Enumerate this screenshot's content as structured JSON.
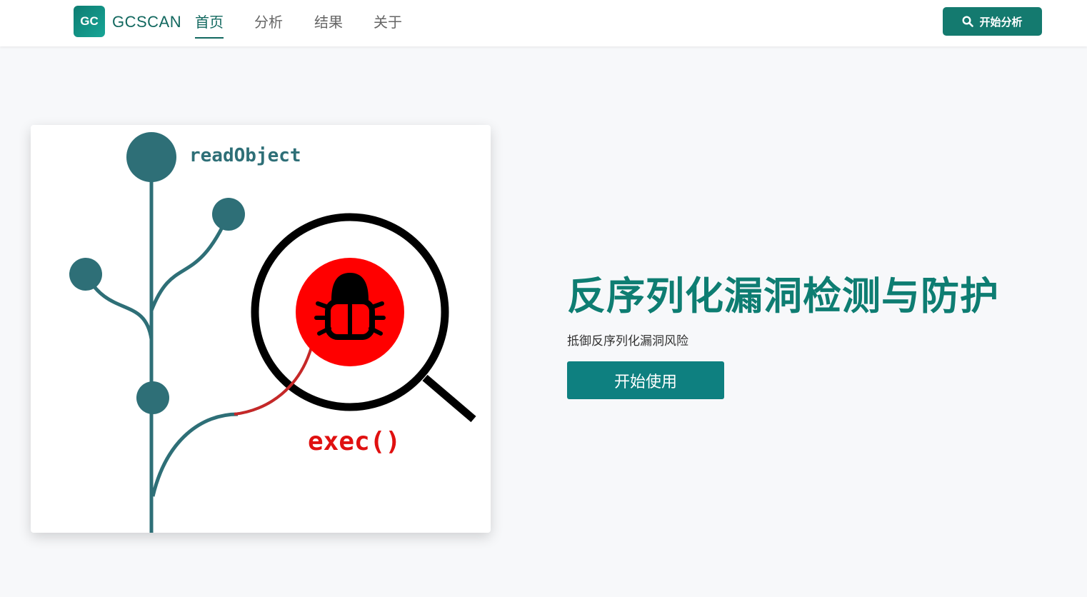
{
  "nav": {
    "logo_text": "GC",
    "brand": "GCSCAN",
    "items": [
      {
        "label": "首页",
        "active": true
      },
      {
        "label": "分析",
        "active": false
      },
      {
        "label": "结果",
        "active": false
      },
      {
        "label": "关于",
        "active": false
      }
    ],
    "cta_label": "开始分析",
    "cta_icon": "search-icon"
  },
  "hero": {
    "illustration": {
      "label_top": "readObject",
      "label_bottom": "exec()"
    },
    "title": "反序列化漏洞检测与防护",
    "subtitle": "抵御反序列化漏洞风险",
    "button_label": "开始使用"
  },
  "colors": {
    "brand": "#12685f",
    "accent": "#0e7d72",
    "tree": "#2e6f77",
    "bug": "#ff0000"
  }
}
